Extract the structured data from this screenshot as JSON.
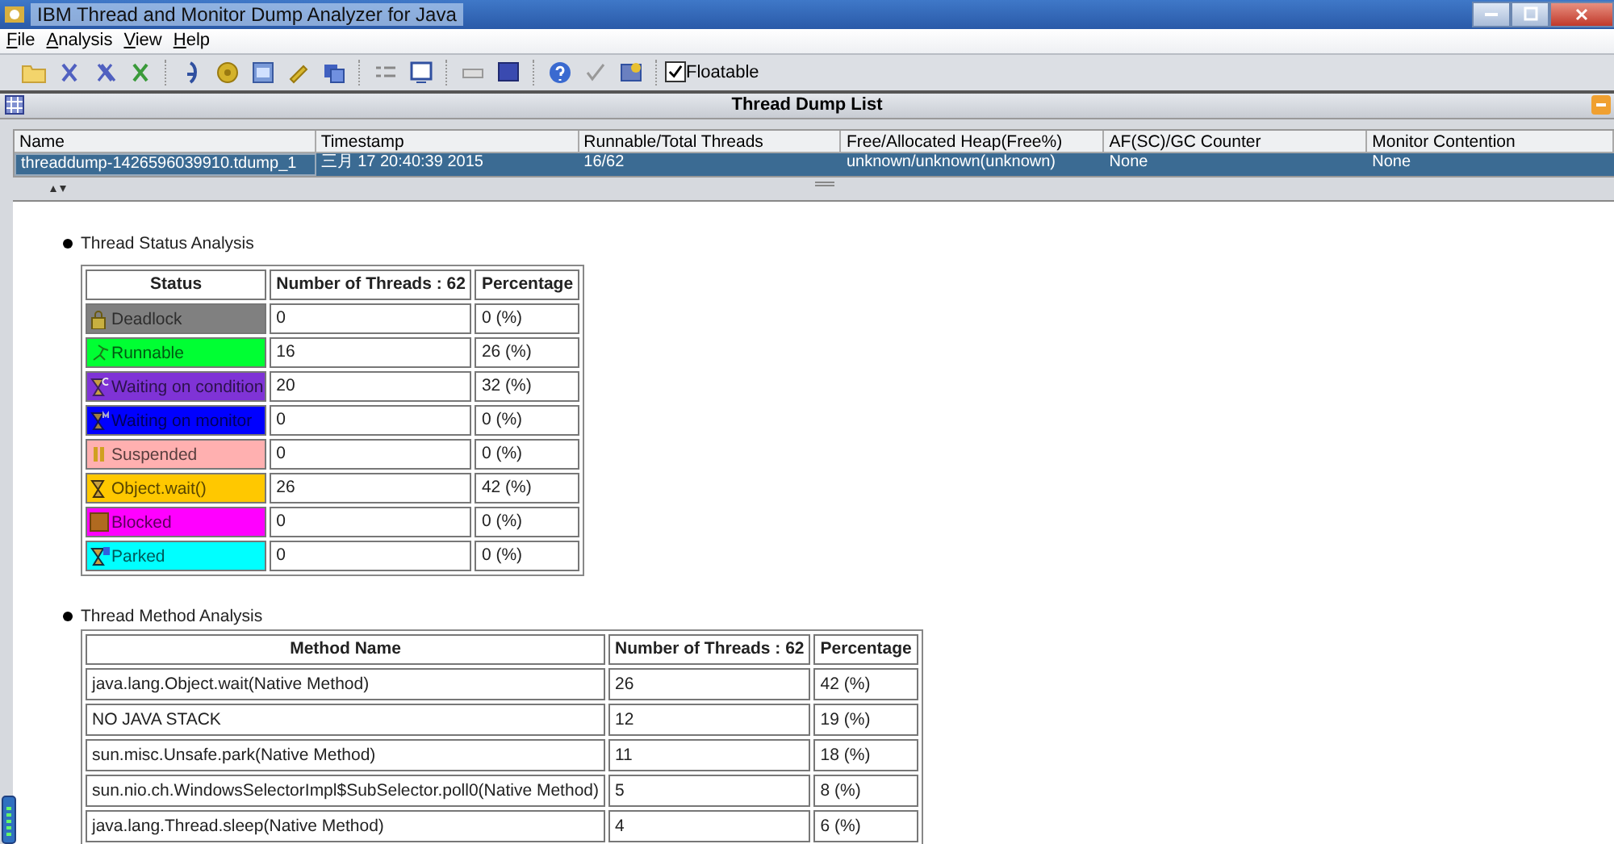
{
  "window": {
    "title": "IBM Thread and Monitor Dump Analyzer for Java"
  },
  "menu": [
    {
      "label": "File"
    },
    {
      "label": "Analysis"
    },
    {
      "label": "View"
    },
    {
      "label": "Help"
    }
  ],
  "toolbar": {
    "floatable": {
      "label": "Floatable",
      "checked": true
    }
  },
  "dump_list": {
    "title": "Thread Dump List",
    "columns": [
      "Name",
      "Timestamp",
      "Runnable/Total Threads",
      "Free/Allocated Heap(Free%)",
      "AF(SC)/GC Counter",
      "Monitor Contention"
    ],
    "rows": [
      {
        "selected": true,
        "cells": [
          "threaddump-1426596039910.tdump_1",
          "三月 17 20:40:39 2015",
          "16/62",
          "unknown/unknown(unknown)",
          "None",
          "None"
        ]
      }
    ]
  },
  "status_analysis": {
    "heading": "Thread Status Analysis",
    "columns": [
      "Status",
      "Number of Threads : 62",
      "Percentage"
    ],
    "rows": [
      {
        "kind": "lock",
        "label": "Deadlock",
        "color": "#808080",
        "count": "0",
        "percent": "0 (%)"
      },
      {
        "kind": "runner",
        "label": "Runnable",
        "color": "#00ff33",
        "count": "16",
        "percent": "26 (%)"
      },
      {
        "kind": "hourglass-c",
        "label": "Waiting on condition",
        "color": "#7f33d6",
        "count": "20",
        "percent": "32 (%)"
      },
      {
        "kind": "hourglass-m",
        "label": "Waiting on monitor",
        "color": "#0000ff",
        "count": "0",
        "percent": "0 (%)"
      },
      {
        "kind": "pause",
        "label": "Suspended",
        "color": "#ffb0b0",
        "count": "0",
        "percent": "0 (%)"
      },
      {
        "kind": "hourglass",
        "label": "Object.wait()",
        "color": "#ffc800",
        "count": "26",
        "percent": "42 (%)"
      },
      {
        "kind": "square",
        "label": "Blocked",
        "color": "#ff00ff",
        "count": "0",
        "percent": "0 (%)"
      },
      {
        "kind": "hourglass-p",
        "label": "Parked",
        "color": "#00ffff",
        "count": "0",
        "percent": "0 (%)"
      }
    ]
  },
  "method_analysis": {
    "heading": "Thread Method Analysis",
    "columns": [
      "Method Name",
      "Number of Threads : 62",
      "Percentage"
    ],
    "rows": [
      [
        "java.lang.Object.wait(Native Method)",
        "26",
        "42 (%)"
      ],
      [
        "NO JAVA STACK",
        "12",
        "19 (%)"
      ],
      [
        "sun.misc.Unsafe.park(Native Method)",
        "11",
        "18 (%)"
      ],
      [
        "sun.nio.ch.WindowsSelectorImpl$SubSelector.poll0(Native Method)",
        "5",
        "8 (%)"
      ],
      [
        "java.lang.Thread.sleep(Native Method)",
        "4",
        "6 (%)"
      ]
    ]
  }
}
